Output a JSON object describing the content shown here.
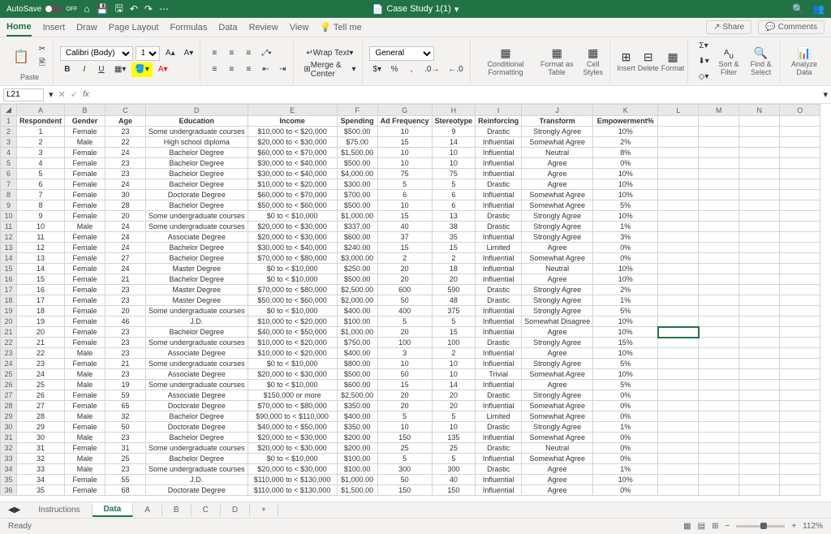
{
  "title": "Case Study 1(1)",
  "autosave": "AutoSave",
  "autosave_state": "OFF",
  "tabs": [
    "Home",
    "Insert",
    "Draw",
    "Page Layout",
    "Formulas",
    "Data",
    "Review",
    "View",
    "Tell me"
  ],
  "share": "Share",
  "comments": "Comments",
  "paste": "Paste",
  "font": "Calibri (Body)",
  "fontsize": "11",
  "wrap": "Wrap Text",
  "merge": "Merge & Center",
  "numfmt": "General",
  "cond": "Conditional Formatting",
  "fmttbl": "Format as Table",
  "cellst": "Cell Styles",
  "insert": "Insert",
  "delete": "Delete",
  "format": "Format",
  "sort": "Sort & Filter",
  "find": "Find & Select",
  "analyze": "Analyze Data",
  "namebox": "L21",
  "cols": [
    "A",
    "B",
    "C",
    "D",
    "E",
    "F",
    "G",
    "H",
    "I",
    "J",
    "K",
    "L",
    "M",
    "N",
    "O"
  ],
  "headers": [
    "Respondent",
    "Gender",
    "Age",
    "Education",
    "Income",
    "Spending",
    "Ad Frequency",
    "Stereotype",
    "Reinforcing",
    "Transform",
    "Empowerment%"
  ],
  "rows": [
    [
      "1",
      "Female",
      "23",
      "Some undergraduate courses",
      "$10,000 to < $20,000",
      "$500.00",
      "10",
      "9",
      "Drastic",
      "Strongly Agree",
      "10%"
    ],
    [
      "2",
      "Male",
      "22",
      "High school diploma",
      "$20,000 to < $30,000",
      "$75.00",
      "15",
      "14",
      "Influential",
      "Somewhat Agree",
      "2%"
    ],
    [
      "3",
      "Female",
      "24",
      "Bachelor Degree",
      "$60,000 to < $70,000",
      "$1,500.00",
      "10",
      "10",
      "Influential",
      "Neutral",
      "8%"
    ],
    [
      "4",
      "Female",
      "23",
      "Bachelor Degree",
      "$30,000 to < $40,000",
      "$500.00",
      "10",
      "10",
      "Influential",
      "Agree",
      "0%"
    ],
    [
      "5",
      "Female",
      "23",
      "Bachelor Degree",
      "$30,000 to < $40,000",
      "$4,000.00",
      "75",
      "75",
      "Influential",
      "Agree",
      "10%"
    ],
    [
      "6",
      "Female",
      "24",
      "Bachelor Degree",
      "$10,000 to < $20,000",
      "$300.00",
      "5",
      "5",
      "Drastic",
      "Agree",
      "10%"
    ],
    [
      "7",
      "Female",
      "30",
      "Doctorate Degree",
      "$60,000 to < $70,000",
      "$700.00",
      "6",
      "6",
      "Influential",
      "Somewhat Agree",
      "10%"
    ],
    [
      "8",
      "Female",
      "28",
      "Bachelor Degree",
      "$50,000 to < $60,000",
      "$500.00",
      "10",
      "6",
      "Influential",
      "Somewhat Agree",
      "5%"
    ],
    [
      "9",
      "Female",
      "20",
      "Some undergraduate courses",
      "$0 to < $10,000",
      "$1,000.00",
      "15",
      "13",
      "Drastic",
      "Strongly Agree",
      "10%"
    ],
    [
      "10",
      "Male",
      "24",
      "Some undergraduate courses",
      "$20,000 to < $30,000",
      "$337.00",
      "40",
      "38",
      "Drastic",
      "Strongly Agree",
      "1%"
    ],
    [
      "11",
      "Female",
      "24",
      "Associate Degree",
      "$20,000 to < $30,000",
      "$600.00",
      "37",
      "35",
      "Influential",
      "Strongly Agree",
      "3%"
    ],
    [
      "12",
      "Female",
      "24",
      "Bachelor Degree",
      "$30,000 to < $40,000",
      "$240.00",
      "15",
      "15",
      "Limited",
      "Agree",
      "0%"
    ],
    [
      "13",
      "Female",
      "27",
      "Bachelor Degree",
      "$70,000 to < $80,000",
      "$3,000.00",
      "2",
      "2",
      "Influential",
      "Somewhat Agree",
      "0%"
    ],
    [
      "14",
      "Female",
      "24",
      "Master Degree",
      "$0 to < $10,000",
      "$250.00",
      "20",
      "18",
      "Influential",
      "Neutral",
      "10%"
    ],
    [
      "15",
      "Female",
      "21",
      "Bachelor Degree",
      "$0 to < $10,000",
      "$500.00",
      "20",
      "20",
      "Influential",
      "Agree",
      "10%"
    ],
    [
      "16",
      "Female",
      "23",
      "Master Degree",
      "$70,000 to < $80,000",
      "$2,500.00",
      "600",
      "590",
      "Drastic",
      "Strongly Agree",
      "2%"
    ],
    [
      "17",
      "Female",
      "23",
      "Master Degree",
      "$50,000 to < $60,000",
      "$2,000.00",
      "50",
      "48",
      "Drastic",
      "Strongly Agree",
      "1%"
    ],
    [
      "18",
      "Female",
      "20",
      "Some undergraduate courses",
      "$0 to < $10,000",
      "$400.00",
      "400",
      "375",
      "Influential",
      "Strongly Agree",
      "5%"
    ],
    [
      "19",
      "Female",
      "46",
      "J.D.",
      "$10,000 to < $20,000",
      "$100.00",
      "5",
      "5",
      "Influential",
      "Somewhat Disagree",
      "10%"
    ],
    [
      "20",
      "Female",
      "23",
      "Bachelor Degree",
      "$40,000 to < $50,000",
      "$1,000.00",
      "20",
      "15",
      "Influential",
      "Agree",
      "10%"
    ],
    [
      "21",
      "Female",
      "23",
      "Some undergraduate courses",
      "$10,000 to < $20,000",
      "$750.00",
      "100",
      "100",
      "Drastic",
      "Strongly Agree",
      "15%"
    ],
    [
      "22",
      "Male",
      "23",
      "Associate Degree",
      "$10,000 to < $20,000",
      "$400.00",
      "3",
      "2",
      "Influential",
      "Agree",
      "10%"
    ],
    [
      "23",
      "Female",
      "21",
      "Some undergraduate courses",
      "$0 to < $10,000",
      "$800.00",
      "10",
      "10",
      "Influential",
      "Strongly Agree",
      "5%"
    ],
    [
      "24",
      "Male",
      "23",
      "Associate Degree",
      "$20,000 to < $30,000",
      "$500.00",
      "50",
      "10",
      "Trivial",
      "Somewhat Agree",
      "10%"
    ],
    [
      "25",
      "Male",
      "19",
      "Some undergraduate courses",
      "$0 to < $10,000",
      "$600.00",
      "15",
      "14",
      "Influential",
      "Agree",
      "5%"
    ],
    [
      "26",
      "Female",
      "59",
      "Associate Degree",
      "$150,000 or more",
      "$2,500.00",
      "20",
      "20",
      "Drastic",
      "Strongly Agree",
      "0%"
    ],
    [
      "27",
      "Female",
      "65",
      "Doctorate Degree",
      "$70,000 to < $80,000",
      "$350.00",
      "20",
      "20",
      "Influential",
      "Somewhat Agree",
      "0%"
    ],
    [
      "28",
      "Male",
      "32",
      "Bachelor Degree",
      "$90,000 to < $110,000",
      "$400.00",
      "5",
      "5",
      "Limited",
      "Somewhat Agree",
      "0%"
    ],
    [
      "29",
      "Female",
      "50",
      "Doctorate Degree",
      "$40,000 to < $50,000",
      "$350.00",
      "10",
      "10",
      "Drastic",
      "Strongly Agree",
      "1%"
    ],
    [
      "30",
      "Male",
      "23",
      "Bachelor Degree",
      "$20,000 to < $30,000",
      "$200.00",
      "150",
      "135",
      "Influential",
      "Somewhat Agree",
      "0%"
    ],
    [
      "31",
      "Female",
      "31",
      "Some undergraduate courses",
      "$20,000 to < $30,000",
      "$200.00",
      "25",
      "25",
      "Drastic",
      "Neutral",
      "0%"
    ],
    [
      "32",
      "Male",
      "25",
      "Bachelor Degree",
      "$0 to < $10,000",
      "$100.00",
      "5",
      "5",
      "Influential",
      "Somewhat Agree",
      "0%"
    ],
    [
      "33",
      "Male",
      "23",
      "Some undergraduate courses",
      "$20,000 to < $30,000",
      "$100.00",
      "300",
      "300",
      "Drastic",
      "Agree",
      "1%"
    ],
    [
      "34",
      "Female",
      "55",
      "J.D.",
      "$110,000 to < $130,000",
      "$1,000.00",
      "50",
      "40",
      "Influential",
      "Agree",
      "10%"
    ],
    [
      "35",
      "Female",
      "68",
      "Doctorate Degree",
      "$110,000 to < $130,000",
      "$1,500.00",
      "150",
      "150",
      "Influential",
      "Agree",
      "0%"
    ]
  ],
  "sheets": [
    "Instructions",
    "Data",
    "A",
    "B",
    "C",
    "D"
  ],
  "activesheet": 1,
  "ready": "Ready",
  "zoom": "112%"
}
